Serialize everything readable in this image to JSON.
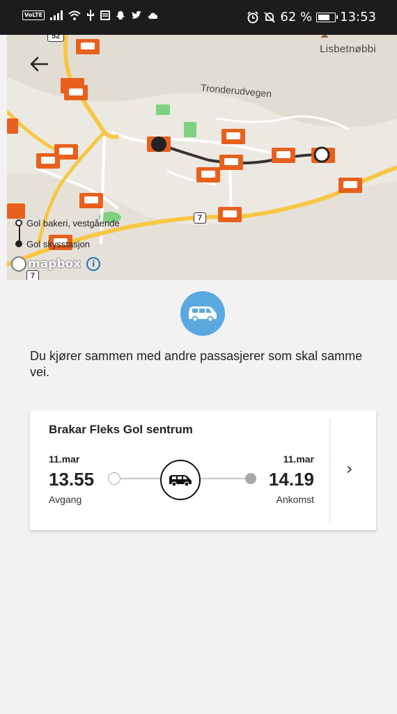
{
  "status_bar": {
    "volte": "VoLTE",
    "icons": [
      "signal-icon",
      "wifi-icon",
      "usb-icon",
      "news-icon",
      "snapchat-icon",
      "twitter-icon",
      "cloud-icon"
    ],
    "alarm_icon": "alarm-icon",
    "mute_icon": "mute-icon",
    "battery_percent": "62 %",
    "time": "13:53"
  },
  "map": {
    "place_label": "Lisbetnøbbi",
    "road_label": "Tronderudvegen",
    "road_shield_top": "52",
    "road_shield_mid": "7",
    "road_shield_bottom": "7",
    "legend": {
      "origin": "Gol bakeri, vestgående",
      "destination": "Gol skysstasjon"
    },
    "attribution": "mapbox",
    "info_icon": "i",
    "colors": {
      "bus_marker": "#e8601c",
      "route": "#333333",
      "road_major": "#f7c744",
      "park": "#7fd17f"
    }
  },
  "mode": {
    "icon": "van-icon",
    "color": "#5aa8e0"
  },
  "info_text": "Du kjører sammen med andre passasjerer som skal samme vei.",
  "trip": {
    "title": "Brakar Fleks Gol sentrum",
    "departure": {
      "date": "11.mar",
      "time": "13.55",
      "label": "Avgang"
    },
    "arrival": {
      "date": "11.mar",
      "time": "14.19",
      "label": "Ankomst"
    },
    "vehicle_icon": "car-icon",
    "chevron": "›"
  }
}
